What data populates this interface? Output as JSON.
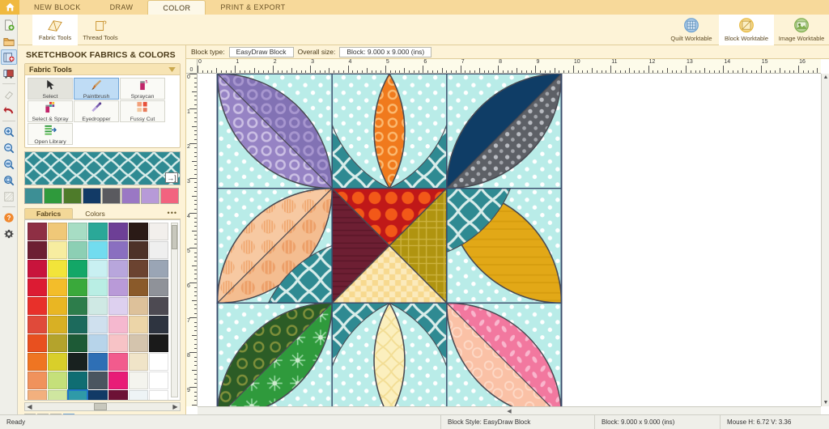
{
  "app": {
    "home_icon": "home-icon"
  },
  "tabs": [
    {
      "label": "NEW BLOCK",
      "active": false
    },
    {
      "label": "DRAW",
      "active": false
    },
    {
      "label": "COLOR",
      "active": true
    },
    {
      "label": "PRINT & EXPORT",
      "active": false
    }
  ],
  "ribbon": {
    "left_buttons": [
      {
        "label": "Fabric Tools",
        "icon": "fabric-tools-icon",
        "selected": true
      },
      {
        "label": "Thread Tools",
        "icon": "thread-tools-icon",
        "selected": false
      }
    ],
    "right_buttons": [
      {
        "label": "Quilt Worktable",
        "icon": "quilt-worktable-icon",
        "color": "#6a9fd0",
        "selected": false
      },
      {
        "label": "Block Worktable",
        "icon": "block-worktable-icon",
        "color": "#e7b93f",
        "selected": true
      },
      {
        "label": "Image Worktable",
        "icon": "image-worktable-icon",
        "color": "#7fae4b",
        "selected": false
      }
    ]
  },
  "left_toolbar": [
    {
      "name": "new-file-icon",
      "label": "New",
      "state": "normal"
    },
    {
      "name": "open-file-icon",
      "label": "Open",
      "state": "normal"
    },
    {
      "name": "add-to-sketchbook-icon",
      "label": "Add to Sketchbook",
      "state": "active"
    },
    {
      "name": "view-sketchbook-icon",
      "label": "View Sketchbook",
      "state": "normal"
    },
    {
      "name": "eraser-icon",
      "label": "Erase",
      "state": "disabled"
    },
    {
      "name": "undo-icon",
      "label": "Undo",
      "state": "normal"
    },
    {
      "name": "zoom-in-icon",
      "label": "Zoom In",
      "state": "normal"
    },
    {
      "name": "zoom-out-icon",
      "label": "Zoom Out",
      "state": "normal"
    },
    {
      "name": "zoom-fit-icon",
      "label": "Fit to Window",
      "state": "normal"
    },
    {
      "name": "zoom-box-icon",
      "label": "Zoom Box",
      "state": "normal"
    },
    {
      "name": "grid-icon",
      "label": "Grid",
      "state": "disabled"
    },
    {
      "name": "help-icon",
      "label": "Help",
      "state": "normal"
    },
    {
      "name": "settings-icon",
      "label": "Settings",
      "state": "normal"
    }
  ],
  "panel": {
    "title": "SKETCHBOOK FABRICS & COLORS",
    "fabric_tools": {
      "header": "Fabric Tools",
      "collapse_icon": "chevron-down-icon",
      "tools": [
        {
          "label": "Select",
          "icon": "cursor-icon",
          "selected": false,
          "pressed": true
        },
        {
          "label": "Paintbrush",
          "icon": "paintbrush-icon",
          "selected": true,
          "pressed": false
        },
        {
          "label": "Spraycan",
          "icon": "spraycan-icon",
          "selected": false,
          "pressed": false
        },
        {
          "label": "Select & Spray",
          "icon": "select-spray-icon",
          "selected": false,
          "pressed": false
        },
        {
          "label": "Eyedropper",
          "icon": "eyedropper-icon",
          "selected": false,
          "pressed": false
        },
        {
          "label": "Fussy Cut",
          "icon": "fussy-cut-icon",
          "selected": false,
          "pressed": false
        },
        {
          "label": "Open Library",
          "icon": "open-library-icon",
          "selected": false,
          "pressed": false
        }
      ]
    },
    "current_fabric": {
      "name": "teal-quatrefoil",
      "base_color": "#2f8a92",
      "pattern_color": "#cfe8e6",
      "expand_icon": "expand-swatch-icon"
    },
    "recent_fabrics": [
      {
        "name": "teal-quatrefoil",
        "color": "#3d8f95"
      },
      {
        "name": "green-starburst",
        "color": "#2f9a3c"
      },
      {
        "name": "olive-circles",
        "color": "#4e7b2a"
      },
      {
        "name": "navy-solid",
        "color": "#123a66"
      },
      {
        "name": "gray-dots",
        "color": "#5a5a5f"
      },
      {
        "name": "purple-texture",
        "color": "#9a78c4"
      },
      {
        "name": "lavender-rings",
        "color": "#b79ad8"
      },
      {
        "name": "pink-swirl",
        "color": "#f2637f"
      }
    ],
    "fabric_tabs": [
      {
        "label": "Fabrics",
        "active": true
      },
      {
        "label": "Colors",
        "active": false
      }
    ],
    "more_options_icon": "more-options-icon",
    "swatch_rows": [
      [
        "#8e2f44",
        "#f0c878",
        "#a7ddc4",
        "#2aa898",
        "#6d3f96",
        "#2a1a16",
        "#f2efec"
      ],
      [
        "#6d1f33",
        "#f7eda0",
        "#8ccfb4",
        "#72dcef",
        "#8a6fc0",
        "#4d3228",
        "#efefef"
      ],
      [
        "#c8143c",
        "#f2e43a",
        "#13a767",
        "#c9f0f2",
        "#b8a6dc",
        "#6b4330",
        "#9aa5b5"
      ],
      [
        "#dc1b33",
        "#f3bd2a",
        "#3aa93b",
        "#b9eee4",
        "#b99ad8",
        "#8a5a2a",
        "#8f9299"
      ],
      [
        "#e8302a",
        "#e9b623",
        "#2d7d4b",
        "#cfe9e4",
        "#ddd0ef",
        "#ddc19a",
        "#4d4a52"
      ],
      [
        "#e04a3a",
        "#d8b024",
        "#1c6a5c",
        "#cfe0ee",
        "#f5b8cf",
        "#ecd5a8",
        "#2e3440"
      ],
      [
        "#e8501f",
        "#b4a32c",
        "#1d5a36",
        "#b7d4ea",
        "#f7c3c6",
        "#d4c4ad",
        "#1a1a1a"
      ],
      [
        "#ef7522",
        "#d9cf2a",
        "#18211f",
        "#2e6fb5",
        "#f25b8d",
        "#f0e4c8",
        "#ffffff"
      ],
      [
        "#f0925c",
        "#c5e07a",
        "#0f6d72",
        "#4a5560",
        "#e81c77",
        "#f4f4ee",
        "#ffffff"
      ],
      [
        "#f2b07e",
        "#cfe6a0",
        "#2f9aa8",
        "#123a66",
        "#6d1236",
        "#eef4f6",
        "#ffffff"
      ]
    ],
    "selected_swatch": {
      "row": 9,
      "col": 2,
      "name": "teal-cloud-fabric"
    },
    "scroll_nav": {
      "left_icon": "scroll-left-icon",
      "right_icon": "scroll-right-icon"
    },
    "size_buttons": [
      {
        "name": "swatch-size-large",
        "active": false
      },
      {
        "name": "swatch-size-medium",
        "active": false
      },
      {
        "name": "swatch-size-small",
        "active": false
      },
      {
        "name": "swatch-size-tiny",
        "active": true
      }
    ]
  },
  "worktable": {
    "block_type_label": "Block type:",
    "block_type_value": "EasyDraw Block",
    "overall_size_label": "Overall size:",
    "overall_size_value": "Block: 9.000 x 9.000 (ins)",
    "ruler_h_max": 16,
    "ruler_v_max": 9,
    "ruler_unit": "inches"
  },
  "block_design": {
    "name": "orange-peel-flower-block",
    "grid": "3x3",
    "background_fabric": {
      "name": "aqua-dots",
      "color": "#b9ece8",
      "dot_color": "#ffffff"
    },
    "corner_fabric": {
      "name": "teal-quatrefoil",
      "color": "#2f8a92"
    },
    "petals": [
      {
        "position": "top-left",
        "light": {
          "name": "lavender-rings",
          "color": "#a894cf"
        },
        "dark": {
          "name": "purple-circles",
          "color": "#8f7bbd"
        }
      },
      {
        "position": "top-center",
        "light": {
          "name": "orange-rings",
          "color": "#f07a1d"
        },
        "dark": {
          "name": "orange-solid",
          "color": "#ea6a12"
        }
      },
      {
        "position": "top-right",
        "light": {
          "name": "gray-dots",
          "color": "#5d6066"
        },
        "dark": {
          "name": "navy-solid",
          "color": "#0f3d66"
        }
      },
      {
        "position": "mid-left",
        "light": {
          "name": "peach-stripe-dots",
          "color": "#f6c49a"
        },
        "dark": {
          "name": "peach-solid",
          "color": "#f2b286"
        }
      },
      {
        "position": "mid-right",
        "light": {
          "name": "gold-texture",
          "color": "#e2a817"
        },
        "dark": {
          "name": "gold-solid",
          "color": "#d99f10"
        }
      },
      {
        "position": "bottom-left",
        "light": {
          "name": "green-starburst",
          "color": "#2f9a3c"
        },
        "dark": {
          "name": "dark-green-circles",
          "color": "#2c5c26"
        }
      },
      {
        "position": "bottom-center",
        "light": {
          "name": "cream-quatrefoil",
          "color": "#fbefbe"
        },
        "dark": {
          "name": "cream-solid",
          "color": "#f8e9ae"
        }
      },
      {
        "position": "bottom-right",
        "light": {
          "name": "peach-swirl",
          "color": "#fac1a6"
        },
        "dark": {
          "name": "pink-leaf",
          "color": "#f2789f"
        }
      }
    ],
    "center_square": {
      "top": {
        "name": "red-orange-dots",
        "color": "#e8401b"
      },
      "left": {
        "name": "dark-maroon",
        "color": "#6d1f33"
      },
      "right": {
        "name": "olive-plaid",
        "color": "#b09410"
      },
      "bottom": {
        "name": "cream-gingham",
        "color": "#f7d98f"
      }
    }
  },
  "status_bar": {
    "ready": "Ready",
    "block_style": "Block Style: EasyDraw Block",
    "block_size": "Block: 9.000 x 9.000 (ins)",
    "mouse": "Mouse  H:  6.72   V:  3.36"
  }
}
